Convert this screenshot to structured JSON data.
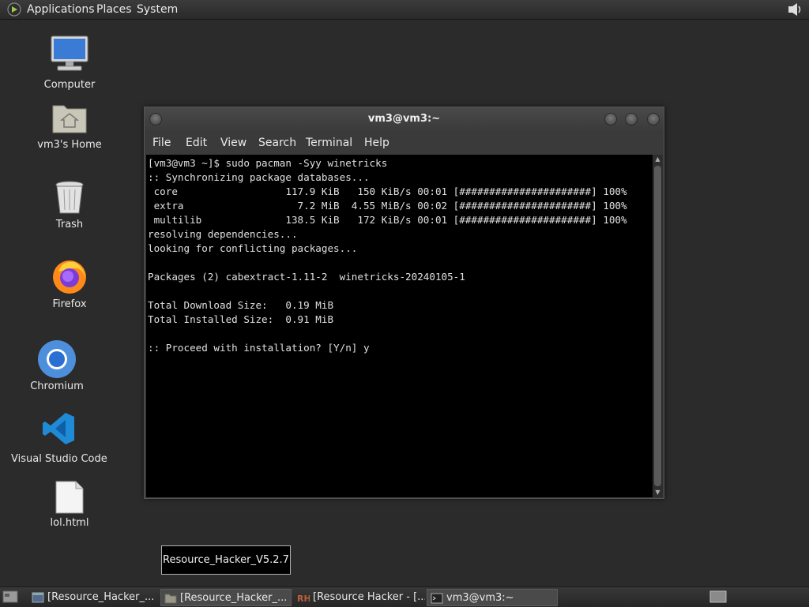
{
  "top_panel": {
    "menus": [
      "Applications",
      "Places",
      "System"
    ]
  },
  "desktop": {
    "icons": [
      {
        "label": "Computer",
        "icon": "computer-icon"
      },
      {
        "label": "vm3's Home",
        "icon": "home-folder-icon"
      },
      {
        "label": "Trash",
        "icon": "trash-icon"
      },
      {
        "label": "Firefox",
        "icon": "firefox-icon"
      },
      {
        "label": "Chromium",
        "icon": "chromium-icon"
      },
      {
        "label": "Visual Studio Code",
        "icon": "vscode-icon"
      },
      {
        "label": "lol.html",
        "icon": "html-file-icon"
      }
    ]
  },
  "terminal": {
    "title": "vm3@vm3:~",
    "menu": [
      "File",
      "Edit",
      "View",
      "Search",
      "Terminal",
      "Help"
    ],
    "lines": [
      "[vm3@vm3 ~]$ sudo pacman -Syy winetricks",
      ":: Synchronizing package databases...",
      " core                  117.9 KiB   150 KiB/s 00:01 [######################] 100%",
      " extra                   7.2 MiB  4.55 MiB/s 00:02 [######################] 100%",
      " multilib              138.5 KiB   172 KiB/s 00:01 [######################] 100%",
      "resolving dependencies...",
      "looking for conflicting packages...",
      "",
      "Packages (2) cabextract-1.11-2  winetricks-20240105-1",
      "",
      "Total Download Size:   0.19 MiB",
      "Total Installed Size:  0.91 MiB",
      "",
      ":: Proceed with installation? [Y/n] y"
    ]
  },
  "tooltip": "Resource_Hacker_V5.2.7",
  "taskbar": {
    "items": [
      {
        "label": "[Resource_Hacker_...",
        "icon": "app-window-icon",
        "active": false
      },
      {
        "label": "[Resource_Hacker_...",
        "icon": "folder-icon",
        "active": true
      },
      {
        "label": "[Resource Hacker - [...",
        "icon": "resource-hacker-icon",
        "active": false
      },
      {
        "label": "vm3@vm3:~",
        "icon": "terminal-icon",
        "active": true
      }
    ]
  }
}
